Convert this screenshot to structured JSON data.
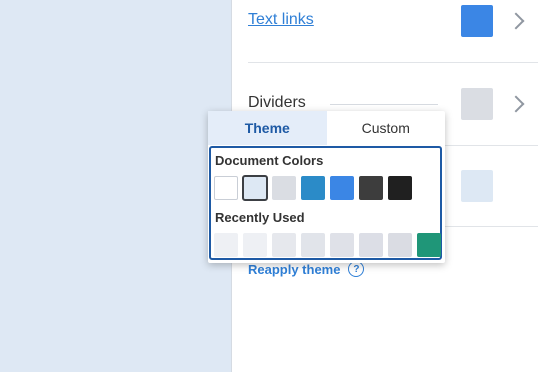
{
  "sidebar": {
    "text_links": {
      "label": "Text links",
      "color": "#3b86e5"
    },
    "dividers": {
      "label": "Dividers",
      "color": "#dadde3"
    },
    "third_swatch_color": "#dde8f4",
    "reapply": {
      "label": "Reapply theme",
      "help": "?"
    }
  },
  "popover": {
    "tabs": [
      {
        "label": "Theme",
        "active": true
      },
      {
        "label": "Custom",
        "active": false
      }
    ],
    "document_colors": {
      "title": "Document Colors",
      "colors": [
        "#ffffff",
        "#dde8f4",
        "#dadde3",
        "#2b8bc8",
        "#3b86e5",
        "#3d3d3d",
        "#202020"
      ],
      "selected_index": 1
    },
    "recently_used": {
      "title": "Recently Used",
      "colors": [
        "#eef0f4",
        "#eef0f4",
        "#e6e8ed",
        "#e1e4ea",
        "#dfe1e8",
        "#dcdee6",
        "#dadce3",
        "#1f9678"
      ]
    }
  }
}
